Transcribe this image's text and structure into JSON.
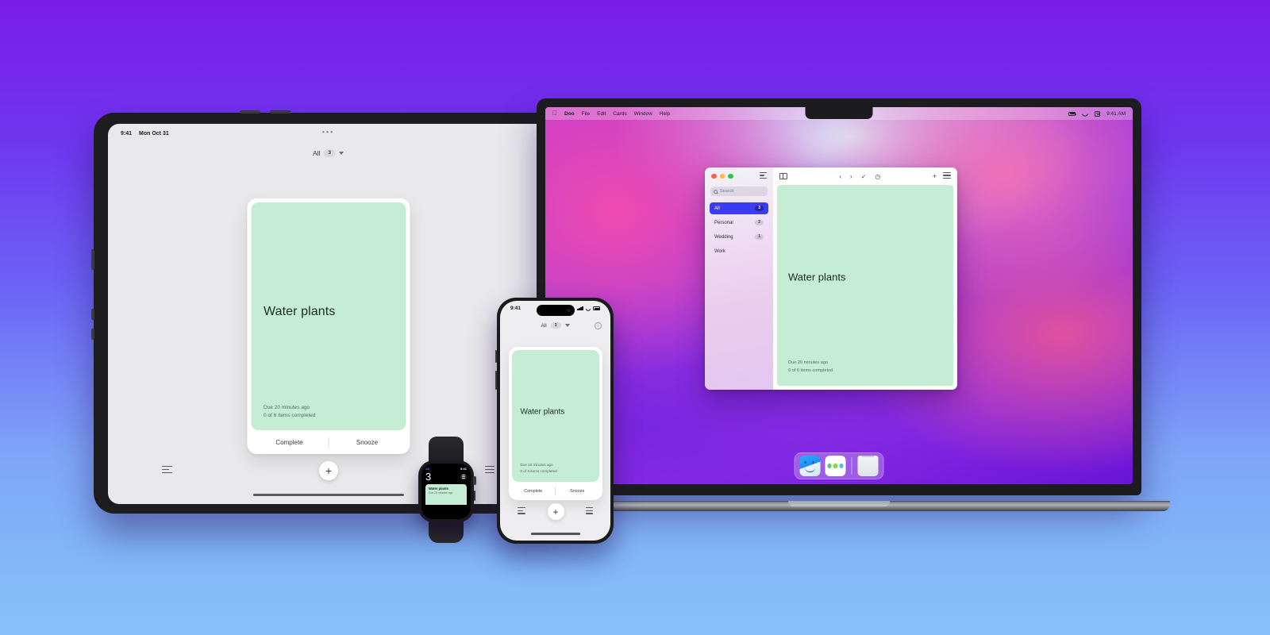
{
  "app": {
    "name": "Doo",
    "accent": "#3b3bf0",
    "card_color": "#c4edd3"
  },
  "background": {
    "top_color": "#7b1ce8",
    "bottom_color": "#86c3f9"
  },
  "tablet": {
    "status": {
      "time": "9:41",
      "date": "Mon Oct 31",
      "more": "•••"
    },
    "filter": {
      "label": "All",
      "count": "3"
    },
    "card": {
      "title": "Water plants",
      "due": "Due 20 minutes ago",
      "progress": "0 of 6 items completed",
      "complete_label": "Complete",
      "snooze_label": "Snooze"
    },
    "toolbar": {
      "filter_icon": "filter-icon",
      "add_label": "+",
      "menu_icon": "hamburger-icon"
    }
  },
  "mac": {
    "menubar": {
      "apple": "",
      "items": [
        "Doo",
        "File",
        "Edit",
        "Cards",
        "Window",
        "Help"
      ],
      "time": "9:41 AM",
      "status_icons": [
        "battery-icon",
        "wifi-icon",
        "control-center-icon"
      ]
    },
    "window": {
      "search_placeholder": "Search",
      "sidebar": [
        {
          "label": "All",
          "count": "3",
          "selected": true
        },
        {
          "label": "Personal",
          "count": "2",
          "selected": false
        },
        {
          "label": "Wedding",
          "count": "1",
          "selected": false
        },
        {
          "label": "Work",
          "count": "",
          "selected": false
        }
      ],
      "toolbar_icons": [
        "sidebar-toggle-icon",
        "back-icon",
        "forward-icon",
        "complete-check-icon",
        "snooze-clock-icon",
        "add-icon",
        "list-menu-icon"
      ],
      "back_glyph": "‹",
      "forward_glyph": "›",
      "check_glyph": "✓",
      "snooze_glyph": "◷",
      "add_glyph": "+",
      "card": {
        "title": "Water plants",
        "due": "Due 20 minutes ago",
        "progress": "0 of 6 items completed"
      }
    },
    "dock": {
      "items": [
        "finder-icon",
        "doo-app-icon",
        "trash-icon"
      ],
      "doo_dot_colors": [
        "#4ad07a",
        "#8fd34f",
        "#4dc3e0"
      ]
    }
  },
  "iphone": {
    "status": {
      "time": "9:41"
    },
    "filter": {
      "label": "All",
      "count": "3"
    },
    "info_glyph": "i",
    "card": {
      "title": "Water plants",
      "due": "Due 20 minutes ago",
      "progress": "0 of 6 items completed",
      "complete_label": "Complete",
      "snooze_label": "Snooze"
    },
    "toolbar": {
      "add_label": "+"
    }
  },
  "watch": {
    "filter_label": "All",
    "time": "9:41",
    "count": "3",
    "card": {
      "title": "Water plants",
      "due": "Due 20 minutes ago"
    }
  }
}
